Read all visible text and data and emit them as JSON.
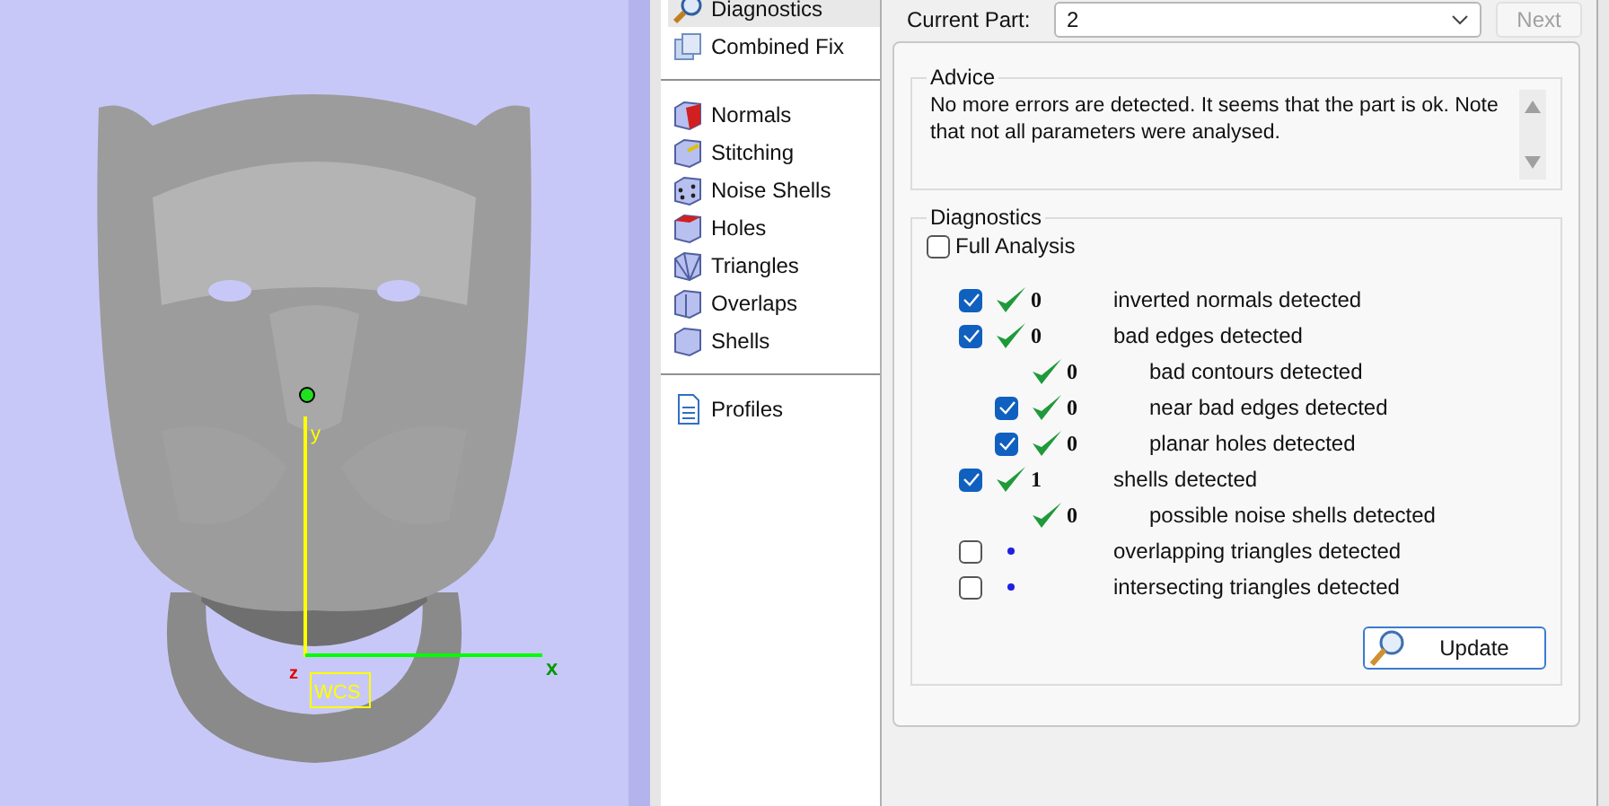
{
  "viewport": {
    "axis_labels": {
      "y": "y",
      "x": "x",
      "z": "z",
      "frame": "WCS"
    }
  },
  "nav": {
    "groups": [
      [
        {
          "label": "Diagnostics",
          "selected": true
        },
        {
          "label": "Combined Fix",
          "selected": false
        }
      ],
      [
        {
          "label": "Normals",
          "selected": false
        },
        {
          "label": "Stitching",
          "selected": false
        },
        {
          "label": "Noise Shells",
          "selected": false
        },
        {
          "label": "Holes",
          "selected": false
        },
        {
          "label": "Triangles",
          "selected": false
        },
        {
          "label": "Overlaps",
          "selected": false
        },
        {
          "label": "Shells",
          "selected": false
        }
      ],
      [
        {
          "label": "Profiles",
          "selected": false
        }
      ]
    ]
  },
  "current_part": {
    "label": "Current Part:",
    "value": "2",
    "next": {
      "label": "Next",
      "disabled": true
    }
  },
  "advice": {
    "title": "Advice",
    "text": "No more errors are detected. It seems that the part is ok. Note that not all parameters were analysed."
  },
  "diagnostics": {
    "title": "Diagnostics",
    "full_analysis": {
      "label": "Full Analysis",
      "checked": false
    },
    "items": [
      {
        "kind": "checkbox",
        "checked": true,
        "passed": true,
        "count": "0",
        "label": "inverted normals detected"
      },
      {
        "kind": "checkbox",
        "checked": true,
        "passed": true,
        "count": "0",
        "label": "bad edges detected",
        "children": [
          {
            "kind": "plain",
            "passed": true,
            "count": "0",
            "label": "bad contours detected"
          },
          {
            "kind": "checkbox",
            "checked": true,
            "passed": true,
            "count": "0",
            "label": "near bad edges detected"
          },
          {
            "kind": "checkbox",
            "checked": true,
            "passed": true,
            "count": "0",
            "label": "planar holes detected"
          }
        ]
      },
      {
        "kind": "checkbox",
        "checked": true,
        "passed": true,
        "count": "1",
        "label": "shells detected",
        "children": [
          {
            "kind": "plain",
            "passed": true,
            "count": "0",
            "label": "possible noise shells detected"
          }
        ]
      },
      {
        "kind": "checkbox",
        "checked": false,
        "passed": false,
        "label": "overlapping triangles detected"
      },
      {
        "kind": "checkbox",
        "checked": false,
        "passed": false,
        "label": "intersecting triangles detected"
      }
    ],
    "update_button": "Update"
  }
}
